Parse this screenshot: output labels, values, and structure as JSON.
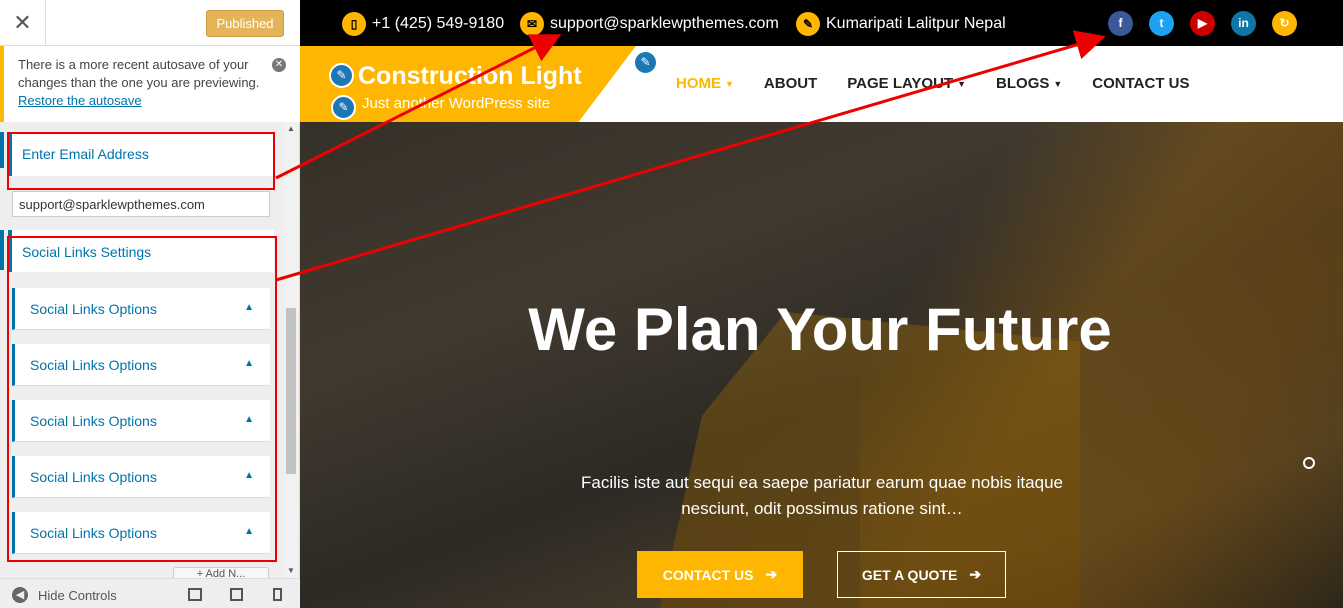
{
  "customizer": {
    "close_label": "✕",
    "publish_label": "Published",
    "notice": {
      "text": "There is a more recent autosave of your changes than the one you are previewing.",
      "link": "Restore the autosave"
    },
    "email_section": {
      "title": "Enter Email Address",
      "value": "support@sparklewpthemes.com"
    },
    "social_section": {
      "title": "Social Links Settings",
      "items": [
        {
          "label": "Social Links Options"
        },
        {
          "label": "Social Links Options"
        },
        {
          "label": "Social Links Options"
        },
        {
          "label": "Social Links Options"
        },
        {
          "label": "Social Links Options"
        }
      ],
      "add_button": "+ Add N..."
    },
    "footer": {
      "hide_controls": "Hide Controls"
    }
  },
  "site": {
    "topbar": {
      "phone": "+1 (425) 549-9180",
      "email": "support@sparklewpthemes.com",
      "address": "Kumaripati Lalitpur Nepal",
      "social": [
        {
          "name": "facebook",
          "glyph": "f",
          "color": "#3b5998"
        },
        {
          "name": "twitter",
          "glyph": "t",
          "color": "#1da1f2"
        },
        {
          "name": "youtube",
          "glyph": "▶",
          "color": "#cc0000"
        },
        {
          "name": "linkedin",
          "glyph": "in",
          "color": "#0e76a8"
        },
        {
          "name": "refresh",
          "glyph": "↻",
          "color": "#ffb600"
        }
      ]
    },
    "brand": {
      "title": "Construction Light",
      "tagline": "Just another WordPress site",
      "accent": "#ffb600"
    },
    "menu": [
      {
        "label": "HOME",
        "active": true,
        "dropdown": true
      },
      {
        "label": "ABOUT",
        "active": false,
        "dropdown": false
      },
      {
        "label": "PAGE LAYOUT",
        "active": false,
        "dropdown": true
      },
      {
        "label": "BLOGS",
        "active": false,
        "dropdown": true
      },
      {
        "label": "CONTACT US",
        "active": false,
        "dropdown": false
      }
    ],
    "hero": {
      "title": "We Plan Your Future",
      "text": "Facilis iste aut sequi ea saepe pariatur earum quae nobis itaque nesciunt, odit possimus ratione sint…",
      "btn_contact": "CONTACT US",
      "btn_quote": "GET A QUOTE"
    }
  }
}
